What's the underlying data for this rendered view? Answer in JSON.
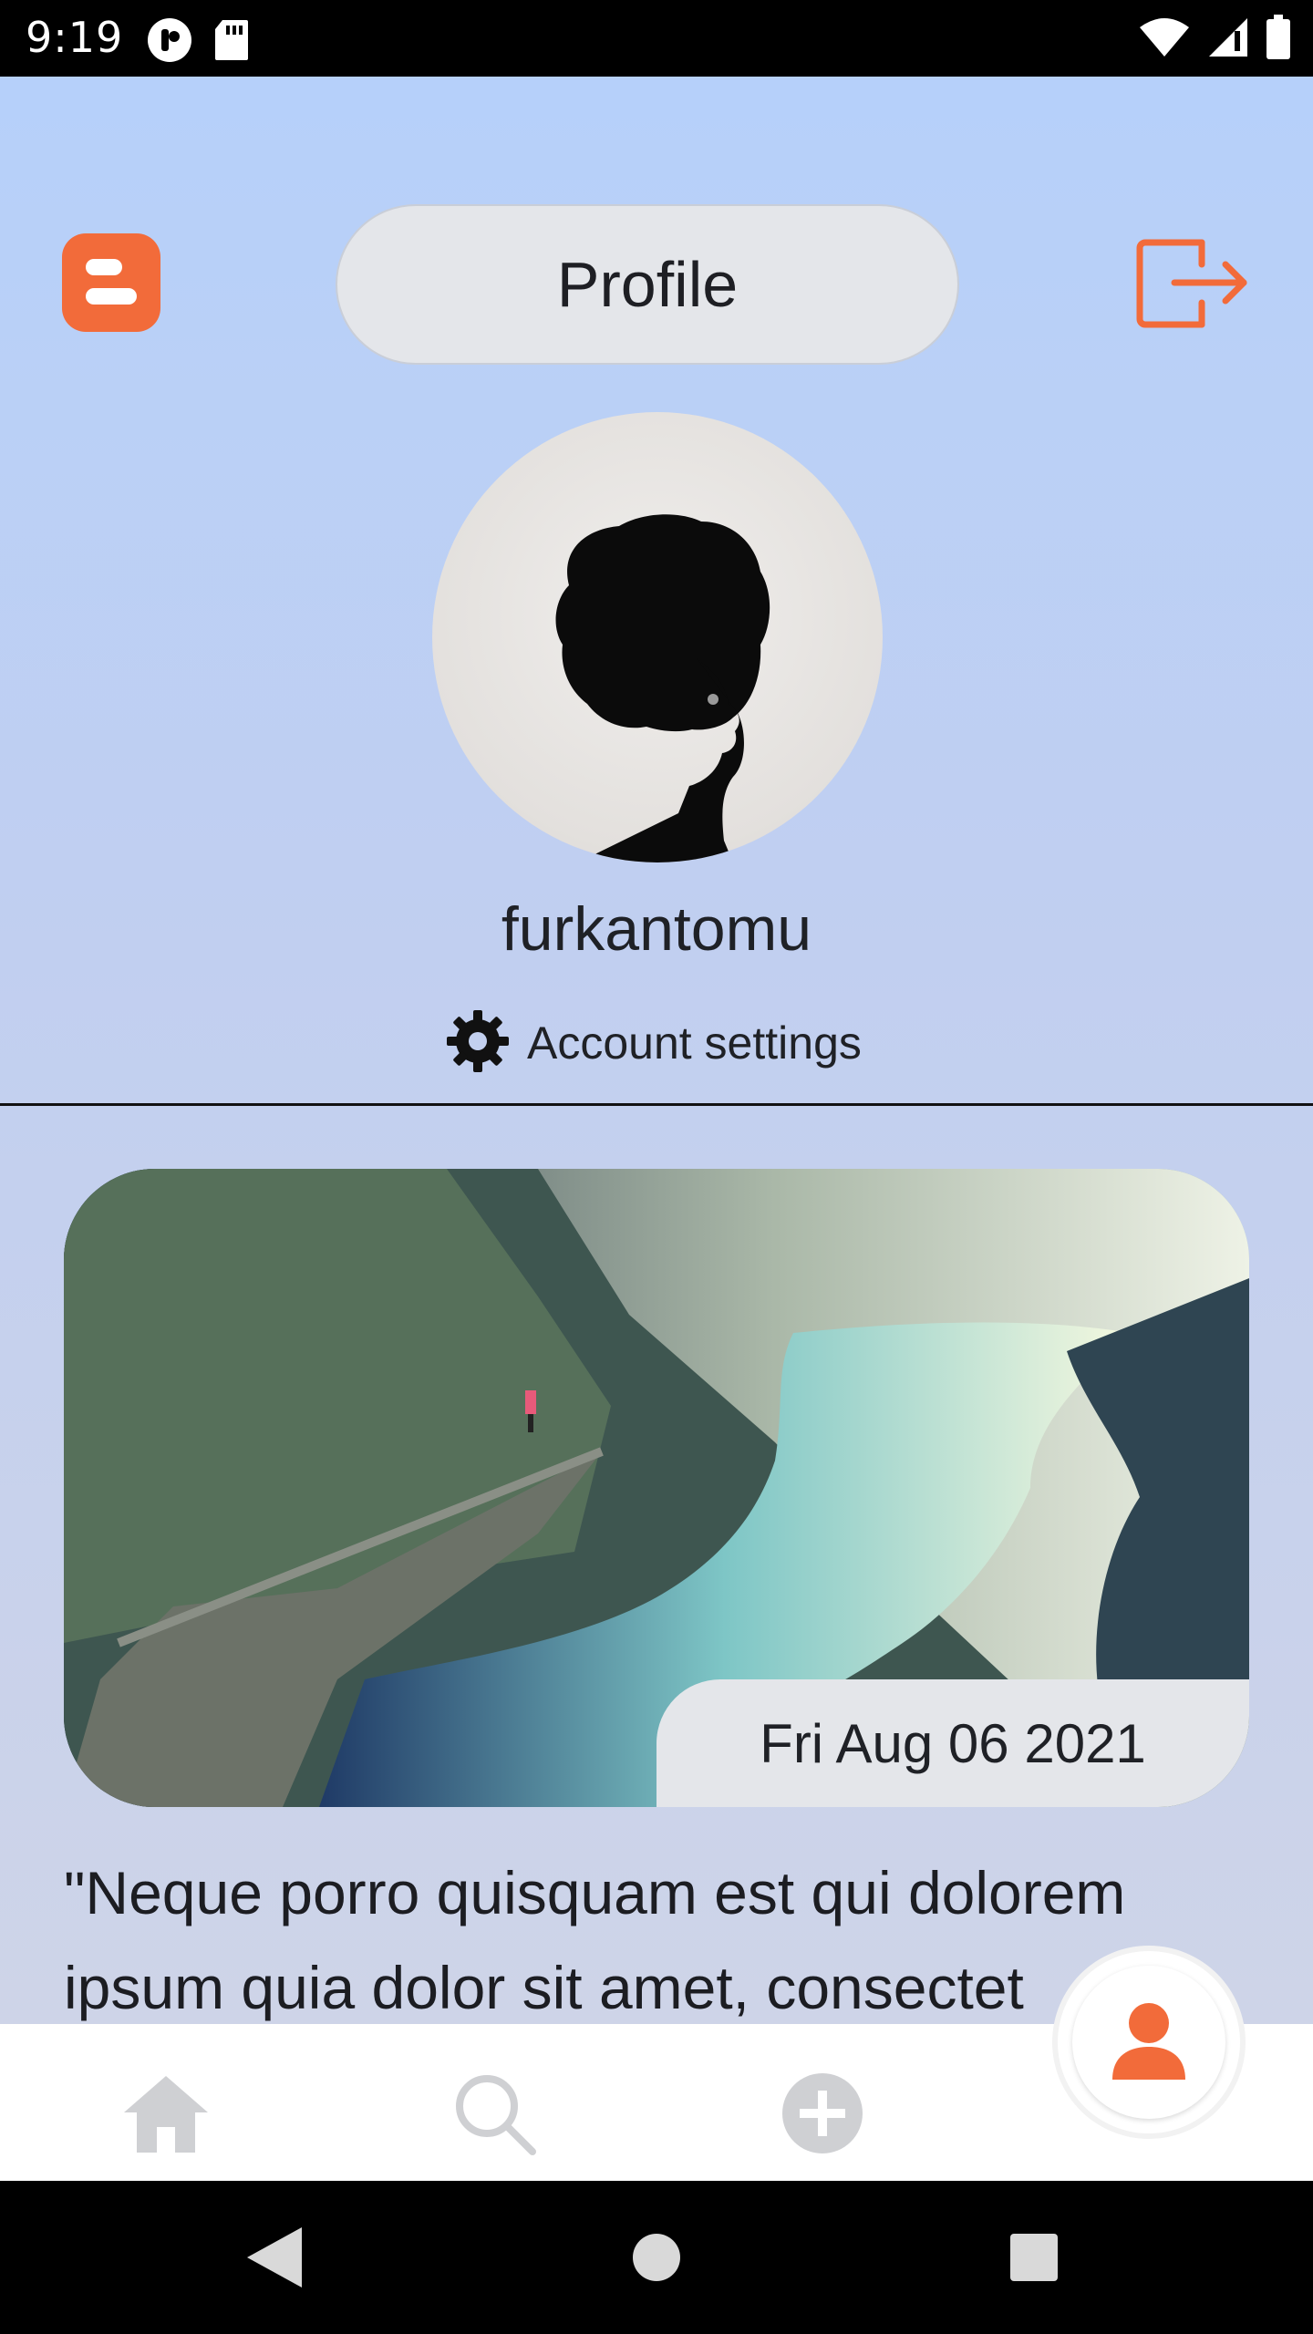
{
  "status_bar": {
    "time": "9:19",
    "left_icons": [
      "notification-app-icon",
      "sd-card-icon"
    ],
    "right_icons": [
      "wifi-icon",
      "signal-icon",
      "battery-icon"
    ]
  },
  "header": {
    "title": "Profile",
    "logo_icon": "blogger-logo-icon",
    "logout_icon": "logout-icon"
  },
  "profile": {
    "username": "furkantomu",
    "settings_label": "Account settings",
    "settings_icon": "gear-icon"
  },
  "post": {
    "date": "Fri Aug 06 2021",
    "text": "\"Neque porro quisquam est qui dolorem ipsum quia dolor sit amet, consectet"
  },
  "bottom_nav": {
    "items": [
      {
        "icon": "home-icon",
        "active": false
      },
      {
        "icon": "search-icon",
        "active": false
      },
      {
        "icon": "add-circle-icon",
        "active": false
      },
      {
        "icon": "profile-icon",
        "active": true
      }
    ]
  },
  "system_nav": [
    "back-icon",
    "home-circle-icon",
    "recents-icon"
  ],
  "colors": {
    "accent": "#f26b3a",
    "inactive_icon": "#cfd0d3",
    "pill_bg": "#e4e6ea",
    "bg_top": "#b6d0fa",
    "bg_bottom": "#ced4e8"
  }
}
